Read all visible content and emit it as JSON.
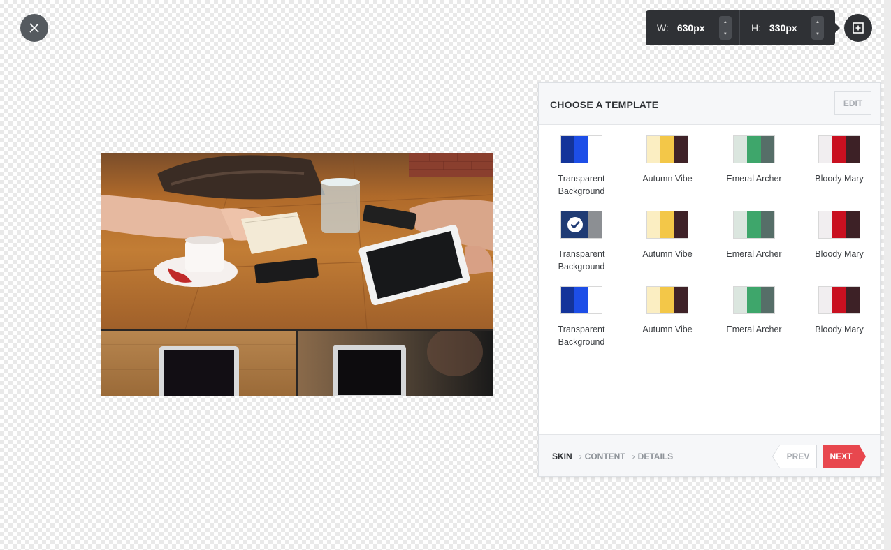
{
  "toolbar": {
    "width_label": "W:",
    "width_value": "630px",
    "height_label": "H:",
    "height_value": "330px"
  },
  "panel": {
    "title": "CHOOSE A TEMPLATE",
    "edit_label": "EDIT"
  },
  "templates": [
    {
      "name": "Transparent Background",
      "colors": [
        "#14349a",
        "#1d4ee8",
        "#ffffff"
      ],
      "selected": false
    },
    {
      "name": "Autumn Vibe",
      "colors": [
        "#fbeec2",
        "#f3c748",
        "#3f2228"
      ],
      "selected": false
    },
    {
      "name": "Emeral Archer",
      "colors": [
        "#dbe6df",
        "#3ea66b",
        "#566e68"
      ],
      "selected": false
    },
    {
      "name": "Bloody Mary",
      "colors": [
        "#f1eef0",
        "#c91020",
        "#3d2126"
      ],
      "selected": false
    },
    {
      "name": "Transparent Background",
      "colors": [
        "#1f3b74",
        "#1f3b74",
        "#8c8f93"
      ],
      "selected": true
    },
    {
      "name": "Autumn Vibe",
      "colors": [
        "#fbeec2",
        "#f3c748",
        "#3f2228"
      ],
      "selected": false
    },
    {
      "name": "Emeral Archer",
      "colors": [
        "#dbe6df",
        "#3ea66b",
        "#566e68"
      ],
      "selected": false
    },
    {
      "name": "Bloody Mary",
      "colors": [
        "#f1eef0",
        "#c91020",
        "#3d2126"
      ],
      "selected": false
    },
    {
      "name": "Transparent Background",
      "colors": [
        "#14349a",
        "#1d4ee8",
        "#ffffff"
      ],
      "selected": false
    },
    {
      "name": "Autumn Vibe",
      "colors": [
        "#fbeec2",
        "#f3c748",
        "#3f2228"
      ],
      "selected": false
    },
    {
      "name": "Emeral Archer",
      "colors": [
        "#dbe6df",
        "#3ea66b",
        "#566e68"
      ],
      "selected": false
    },
    {
      "name": "Bloody Mary",
      "colors": [
        "#f1eef0",
        "#c91020",
        "#3d2126"
      ],
      "selected": false
    }
  ],
  "footer": {
    "steps": [
      "SKIN",
      "CONTENT",
      "DETAILS"
    ],
    "prev_label": "PREV",
    "next_label": "NEXT"
  },
  "colors": {
    "accent": "#e8474e",
    "dark": "#2f3135"
  },
  "icons": {
    "close": "close-icon",
    "crop": "crop-icon",
    "check": "checkmark-icon"
  }
}
